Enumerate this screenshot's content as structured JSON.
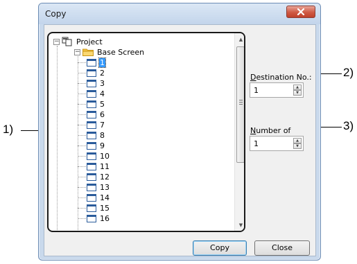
{
  "window": {
    "title": "Copy",
    "close_icon": "close-icon"
  },
  "tree": {
    "root_label": "Project",
    "folder_label": "Base Screen",
    "items": [
      "1",
      "2",
      "3",
      "4",
      "5",
      "6",
      "7",
      "8",
      "9",
      "10",
      "11",
      "12",
      "13",
      "14",
      "15",
      "16"
    ],
    "selected_item": "1"
  },
  "destination": {
    "label_accel": "D",
    "label_rest": "estination No.:",
    "value": "1"
  },
  "copies": {
    "label_accel": "N",
    "label_rest": "umber of Copies:",
    "value": "1"
  },
  "buttons": {
    "copy": "Copy",
    "close": "Close"
  },
  "callouts": {
    "tree": "1)",
    "destination": "2)",
    "copies": "3)"
  }
}
